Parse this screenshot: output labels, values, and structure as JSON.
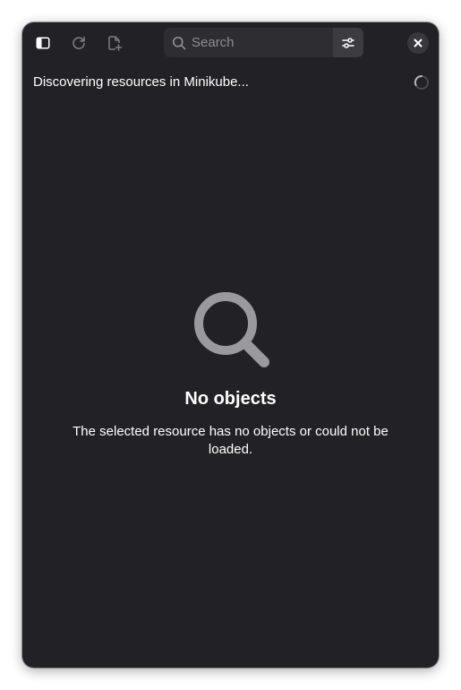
{
  "headerbar": {
    "sidebar_toggle_icon": "sidebar-show-icon",
    "reload_icon": "reload-icon",
    "new_resource_icon": "document-new-icon",
    "search": {
      "placeholder": "Search",
      "value": ""
    },
    "filter_icon": "filter-sliders-icon",
    "close_icon": "window-close-icon"
  },
  "status": {
    "text": "Discovering resources in Minikube...",
    "spinner_icon": "loading-spinner-icon"
  },
  "empty_state": {
    "icon": "search-icon",
    "title": "No objects",
    "description": "The selected resource has no objects or could not be loaded."
  },
  "colors": {
    "window_bg": "#222226",
    "search_bg": "#2e2e32",
    "icon_muted": "#9a9a9e",
    "text": "#ffffff"
  }
}
